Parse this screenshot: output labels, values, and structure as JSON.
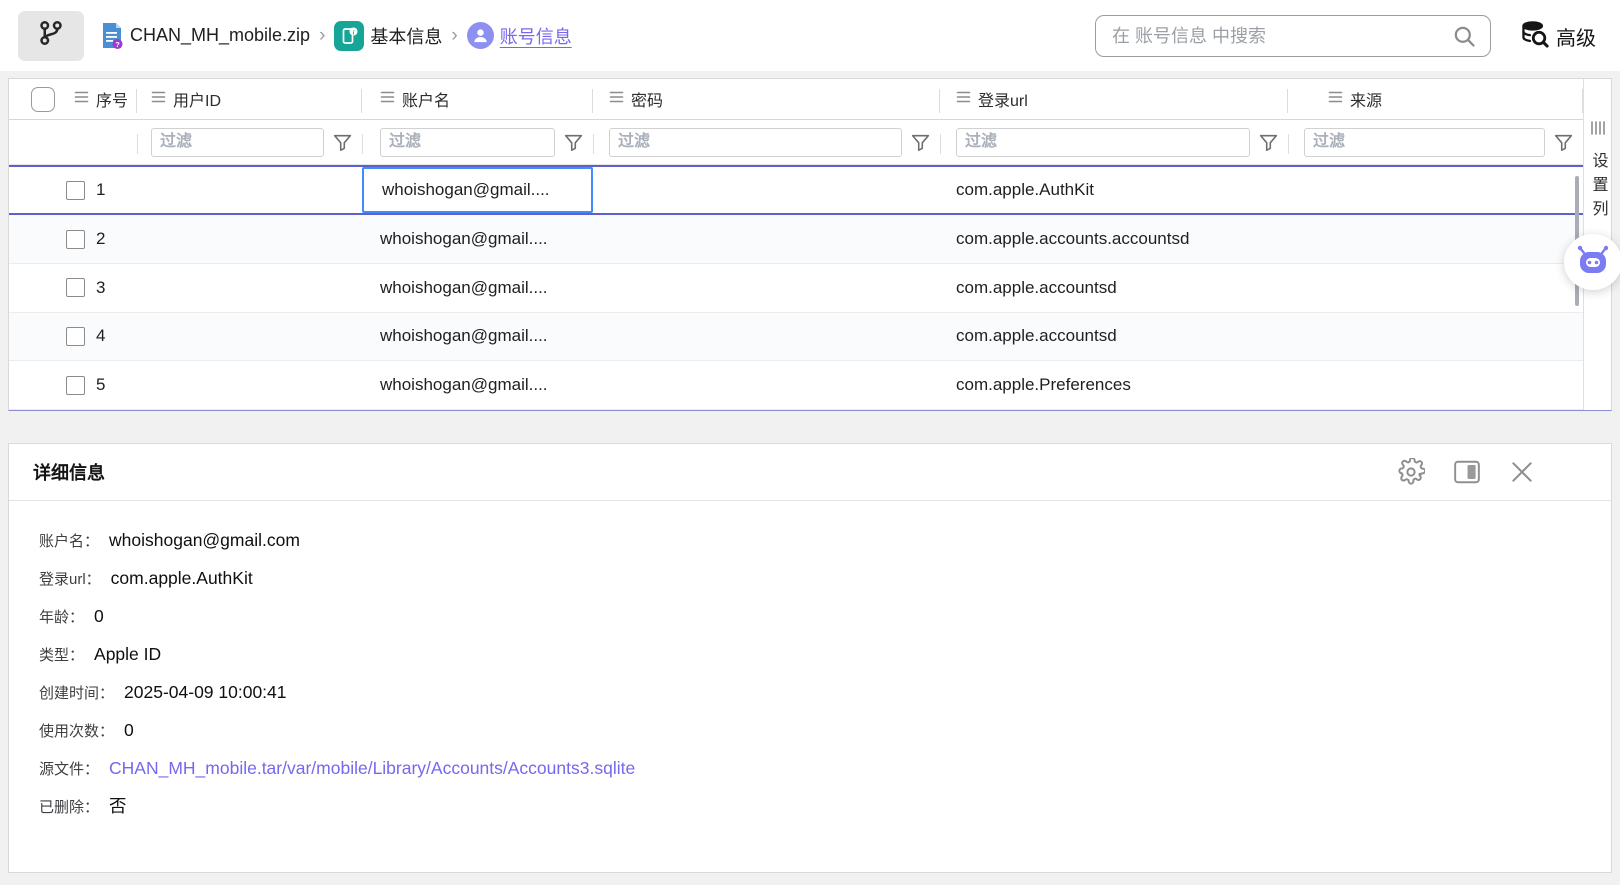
{
  "toolbar": {
    "breadcrumb": {
      "file_label": "CHAN_MH_mobile.zip",
      "separator": "›",
      "section_label": "基本信息",
      "page_label": "账号信息"
    },
    "search_placeholder": "在 账号信息 中搜索",
    "advanced_label": "高级"
  },
  "table": {
    "filter_placeholder": "过滤",
    "columns": [
      {
        "label": "序号"
      },
      {
        "label": "用户ID"
      },
      {
        "label": "账户名"
      },
      {
        "label": "密码"
      },
      {
        "label": "登录url"
      },
      {
        "label": "来源"
      }
    ],
    "rows": [
      {
        "index": "1",
        "user_id": "",
        "account": "whoishogan@gmail....",
        "password": "",
        "login_url": "com.apple.AuthKit",
        "source": ""
      },
      {
        "index": "2",
        "user_id": "",
        "account": "whoishogan@gmail....",
        "password": "",
        "login_url": "com.apple.accounts.accountsd",
        "source": ""
      },
      {
        "index": "3",
        "user_id": "",
        "account": "whoishogan@gmail....",
        "password": "",
        "login_url": "com.apple.accountsd",
        "source": ""
      },
      {
        "index": "4",
        "user_id": "",
        "account": "whoishogan@gmail....",
        "password": "",
        "login_url": "com.apple.accountsd",
        "source": ""
      },
      {
        "index": "5",
        "user_id": "",
        "account": "whoishogan@gmail....",
        "password": "",
        "login_url": "com.apple.Preferences",
        "source": ""
      }
    ],
    "settings_column_label": "设置列"
  },
  "detail": {
    "title": "详细信息",
    "fields": [
      {
        "label": "账户名：",
        "value": "whoishogan@gmail.com"
      },
      {
        "label": "登录url：",
        "value": "com.apple.AuthKit"
      },
      {
        "label": "年龄：",
        "value": "0"
      },
      {
        "label": "类型：",
        "value": "Apple ID"
      },
      {
        "label": "创建时间：",
        "value": "2025-04-09 10:00:41"
      },
      {
        "label": "使用次数：",
        "value": "0"
      },
      {
        "label": "源文件：",
        "value": "CHAN_MH_mobile.tar/var/mobile/Library/Accounts/Accounts3.sqlite"
      },
      {
        "label": "已删除：",
        "value": "否"
      }
    ]
  },
  "icons": {
    "tree": "branch-icon",
    "file": "zip-file-icon",
    "phone": "phone-info-icon",
    "person": "user-icon",
    "search": "search-icon",
    "advanced": "database-search-icon",
    "list": "list-icon",
    "funnel": "filter-funnel-icon",
    "columns": "columns-icon",
    "robot": "ai-robot-icon",
    "gear": "gear-icon",
    "panel": "split-panel-icon",
    "close": "close-icon"
  },
  "colors": {
    "accent_purple": "#7668ee",
    "selected_row_border": "#5d61c9",
    "selected_cell_border": "#3f8cfd",
    "teal_icon": "#16a596",
    "file_blue": "#4a8fd4",
    "robot_purple": "#7b7bf3",
    "panel_border": "#d9d9d9",
    "alt_row": "#fafbfd"
  }
}
